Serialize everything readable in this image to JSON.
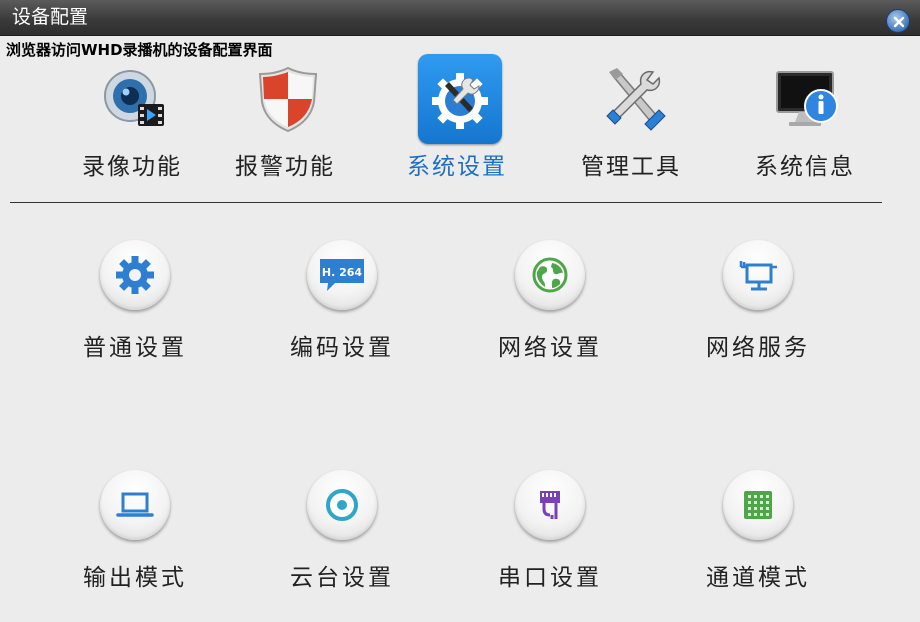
{
  "window": {
    "title": "设备配置",
    "close_icon": "close-icon"
  },
  "subtitle": "浏览器访问WHD录播机的设备配置界面",
  "top_nav": {
    "items": [
      {
        "label": "录像功能",
        "icon": "record-camera-icon",
        "selected": false
      },
      {
        "label": "报警功能",
        "icon": "alarm-shield-icon",
        "selected": false
      },
      {
        "label": "系统设置",
        "icon": "system-settings-icon",
        "selected": true
      },
      {
        "label": "管理工具",
        "icon": "tools-icon",
        "selected": false
      },
      {
        "label": "系统信息",
        "icon": "system-info-icon",
        "selected": false
      }
    ]
  },
  "grid": {
    "items": [
      {
        "label": "普通设置",
        "icon": "gear-icon"
      },
      {
        "label": "编码设置",
        "icon": "h264-icon",
        "icon_text": "H. 264"
      },
      {
        "label": "网络设置",
        "icon": "globe-icon"
      },
      {
        "label": "网络服务",
        "icon": "network-service-icon"
      },
      {
        "label": "输出模式",
        "icon": "laptop-icon"
      },
      {
        "label": "云台设置",
        "icon": "ptz-icon"
      },
      {
        "label": "串口设置",
        "icon": "serial-port-icon"
      },
      {
        "label": "通道模式",
        "icon": "channel-grid-icon"
      }
    ]
  },
  "colors": {
    "accent": "#1d6fc4",
    "selected_tile": "#1e86e0",
    "icon_blue": "#2f7fd0",
    "titlebar": "#3b3b3b"
  }
}
